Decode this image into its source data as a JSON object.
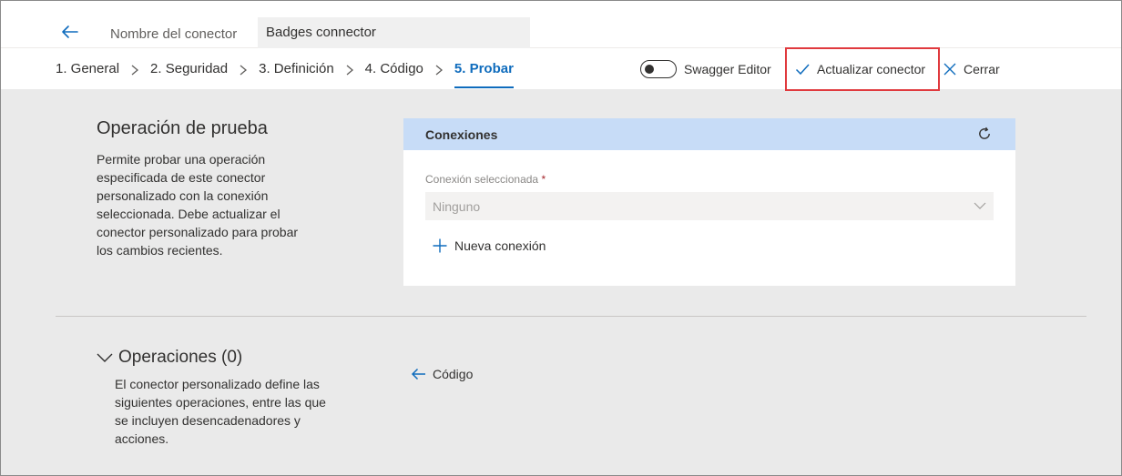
{
  "header": {
    "back_icon": "arrow-left-icon",
    "name_label": "Nombre del conector",
    "name_value": "Badges connector"
  },
  "steps": [
    {
      "label": "1. General",
      "active": false
    },
    {
      "label": "2. Seguridad",
      "active": false
    },
    {
      "label": "3. Definición",
      "active": false
    },
    {
      "label": "4. Código",
      "active": false
    },
    {
      "label": "5. Probar",
      "active": true
    }
  ],
  "toolbar": {
    "swagger_label": "Swagger Editor",
    "swagger_on": false,
    "update_label": "Actualizar conector",
    "close_label": "Cerrar"
  },
  "test": {
    "title": "Operación de prueba",
    "description": "Permite probar una operación especificada de este conector personalizado con la conexión seleccionada. Debe actualizar el conector personalizado para probar los cambios recientes."
  },
  "connections": {
    "title": "Conexiones",
    "selected_label": "Conexión seleccionada",
    "required_mark": "*",
    "selected_value": "Ninguno",
    "new_connection_label": "Nueva conexión"
  },
  "operations": {
    "title": "Operaciones (0)",
    "description": "El conector personalizado define las siguientes operaciones, entre las que se incluyen desencadenadores y acciones.",
    "code_link_label": "Código"
  },
  "colors": {
    "accent": "#0f6cbd",
    "highlight_border": "#e03a3e",
    "card_header": "#c7dcf7",
    "page_bg": "#eaeaea"
  }
}
